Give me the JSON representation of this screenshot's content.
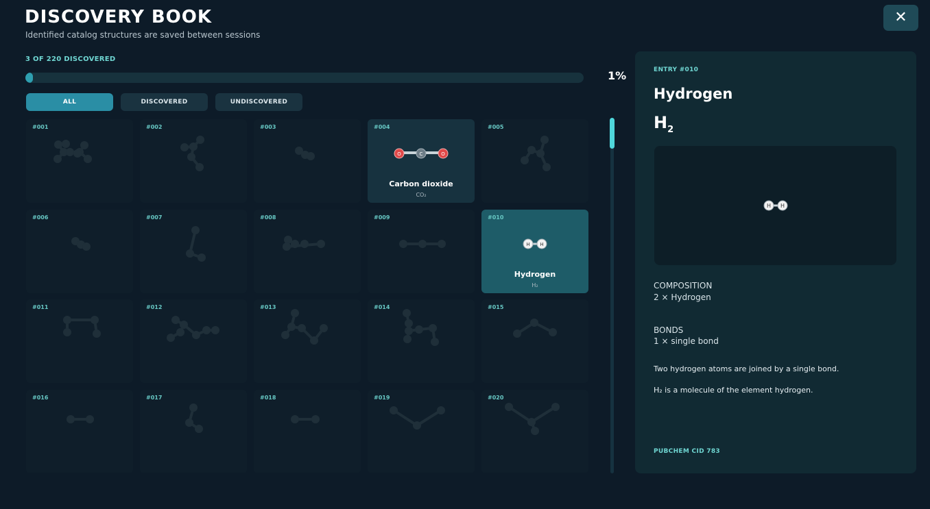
{
  "header": {
    "title": "DISCOVERY BOOK",
    "subtitle": "Identified catalog structures are saved between sessions",
    "close_label": "✕"
  },
  "progress": {
    "count_text": "3 OF 220 DISCOVERED",
    "discovered": 3,
    "total": 220,
    "fraction": 0.0136,
    "percent_text": "1%"
  },
  "filters": [
    {
      "label": "ALL",
      "active": true
    },
    {
      "label": "DISCOVERED",
      "active": false
    },
    {
      "label": "UNDISCOVERED",
      "active": false
    }
  ],
  "entries": [
    {
      "num": "#001",
      "discovered": false
    },
    {
      "num": "#002",
      "discovered": false
    },
    {
      "num": "#003",
      "discovered": false
    },
    {
      "num": "#004",
      "discovered": true,
      "name": "Carbon dioxide",
      "formula": "CO₂"
    },
    {
      "num": "#005",
      "discovered": false
    },
    {
      "num": "#006",
      "discovered": false
    },
    {
      "num": "#007",
      "discovered": false
    },
    {
      "num": "#008",
      "discovered": false
    },
    {
      "num": "#009",
      "discovered": false
    },
    {
      "num": "#010",
      "discovered": true,
      "selected": true,
      "name": "Hydrogen",
      "formula": "H₂"
    },
    {
      "num": "#011",
      "discovered": false
    },
    {
      "num": "#012",
      "discovered": false
    },
    {
      "num": "#013",
      "discovered": false
    },
    {
      "num": "#014",
      "discovered": false
    },
    {
      "num": "#015",
      "discovered": false
    },
    {
      "num": "#016",
      "discovered": false
    },
    {
      "num": "#017",
      "discovered": false
    },
    {
      "num": "#018",
      "discovered": false
    },
    {
      "num": "#019",
      "discovered": false
    },
    {
      "num": "#020",
      "discovered": false
    }
  ],
  "detail": {
    "entry_label": "ENTRY  #010",
    "name": "Hydrogen",
    "formula_main": "H",
    "formula_sub": "2",
    "composition_head": "COMPOSITION",
    "composition_val": "2 × Hydrogen",
    "bonds_head": "BONDS",
    "bonds_val": "1 × single bond",
    "desc1": "Two hydrogen atoms are joined by a single bond.",
    "desc2": "H₂ is a molecule of the element hydrogen.",
    "cid": "PUBCHEM CID  783"
  },
  "colors": {
    "accent": "#6fd6d2",
    "oxygen": "#e04848",
    "carbon": "#6d7d87",
    "hydrogen": "#f2f2f2",
    "silhouette": "#1f2f39"
  }
}
